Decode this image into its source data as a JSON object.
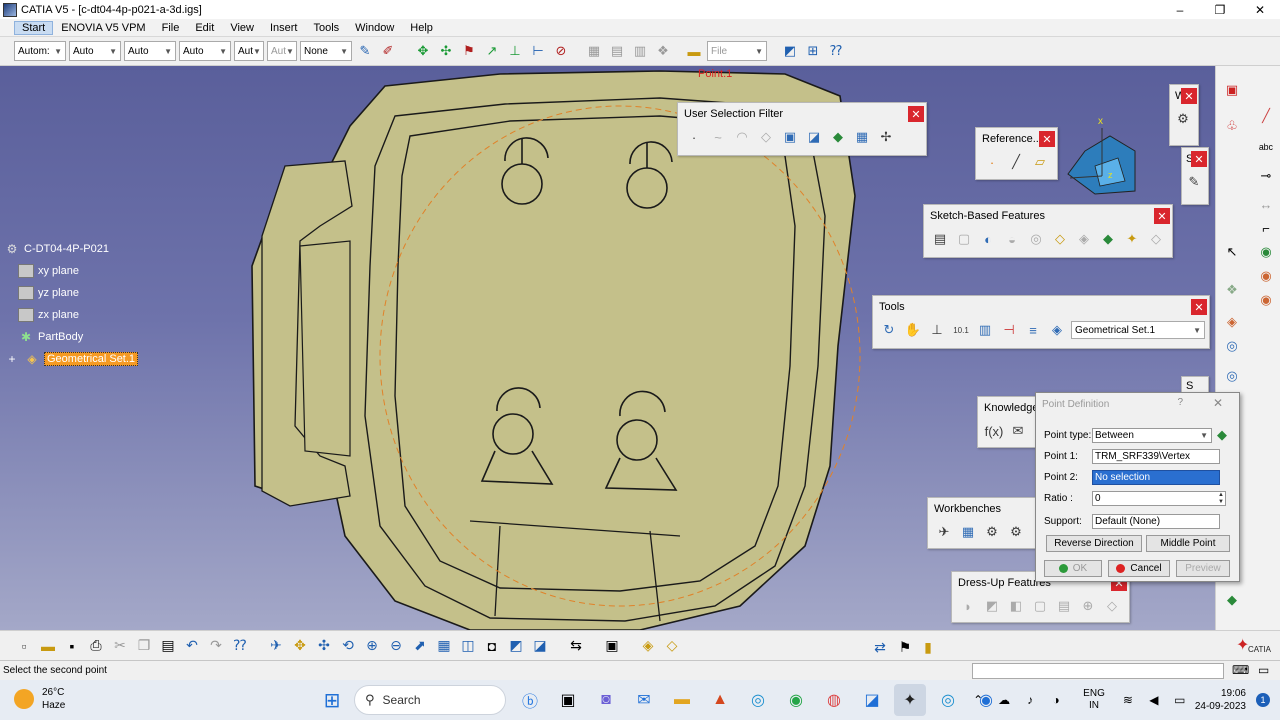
{
  "window": {
    "title": "CATIA V5 - [c-dt04-4p-p021-a-3d.igs]",
    "minimize": "–",
    "restore": "❐",
    "close": "✕"
  },
  "menu": [
    "Start",
    "ENOVIA V5 VPM",
    "File",
    "Edit",
    "View",
    "Insert",
    "Tools",
    "Window",
    "Help"
  ],
  "top_toolbar": {
    "combos": [
      "Autom:",
      "Auto",
      "Auto",
      "Auto",
      "Aut",
      "Aut",
      "None"
    ],
    "file_combo": "File"
  },
  "tree": {
    "root": "C-DT04-4P-P021",
    "items": [
      "xy plane",
      "yz plane",
      "zx plane",
      "PartBody",
      "Geometrical Set.1"
    ]
  },
  "viewport": {
    "point_label": "Point.1",
    "axis_x": "x",
    "axis_z": "z"
  },
  "panels": {
    "user_selection_filter": "User Selection Filter",
    "reference": "Reference...",
    "sketch_based": "Sketch-Based Features",
    "tools": "Tools",
    "tools_combo": "Geometrical Set.1",
    "knowledge": "Knowledge",
    "workbenches": "Workbenches",
    "dress_up": "Dress-Up Features",
    "w_partial": "W",
    "s_partial": "S",
    "s2_partial": "S"
  },
  "point_definition": {
    "title": "Point Definition",
    "help": "?",
    "close": "✕",
    "point_type_label": "Point type:",
    "point_type_value": "Between",
    "point1_label": "Point 1:",
    "point1_value": "TRM_SRF339\\Vertex",
    "point2_label": "Point 2:",
    "point2_value": "No selection",
    "ratio_label": "Ratio :",
    "ratio_value": "0",
    "support_label": "Support:",
    "support_value": "Default (None)",
    "reverse": "Reverse Direction",
    "middle": "Middle Point",
    "ok": "OK",
    "cancel": "Cancel",
    "preview": "Preview"
  },
  "status": {
    "message": "Select the second point",
    "catia_logo": "CATIA"
  },
  "taskbar": {
    "temp": "26°C",
    "condition": "Haze",
    "search": "Search",
    "lang_top": "ENG",
    "lang_bottom": "IN",
    "time": "19:06",
    "date": "24-09-2023",
    "notifications": "1"
  }
}
